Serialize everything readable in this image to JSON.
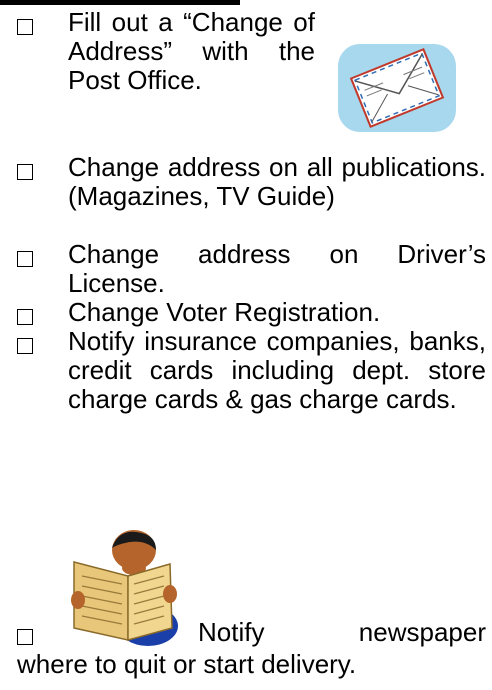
{
  "checklist": {
    "items": [
      {
        "text": "Fill out a “Change of Address” with the Post Office.",
        "checked": false
      },
      {
        "text": "Change address on all publications. (Magazines, TV Guide)",
        "checked": false
      },
      {
        "text": "Change address on Driver’s License.",
        "checked": false
      },
      {
        "text": "Change Voter Registration.",
        "checked": false
      },
      {
        "text": "Notify insurance companies, banks, credit cards including dept. store charge cards & gas charge cards.",
        "checked": false
      },
      {
        "text": "Notify newspaper",
        "continuation": "where to quit or start delivery.",
        "checked": false
      }
    ]
  },
  "colors": {
    "text": "#000000",
    "envelope_bg": "#a8d8ee",
    "envelope_border": "#c0392b",
    "newspaper": "#e8c77a",
    "shirt": "#1a3fa8",
    "skin": "#b5652b"
  },
  "icons": [
    "checkbox-icon",
    "envelope-clipart-icon",
    "newspaper-reader-clipart-icon"
  ]
}
